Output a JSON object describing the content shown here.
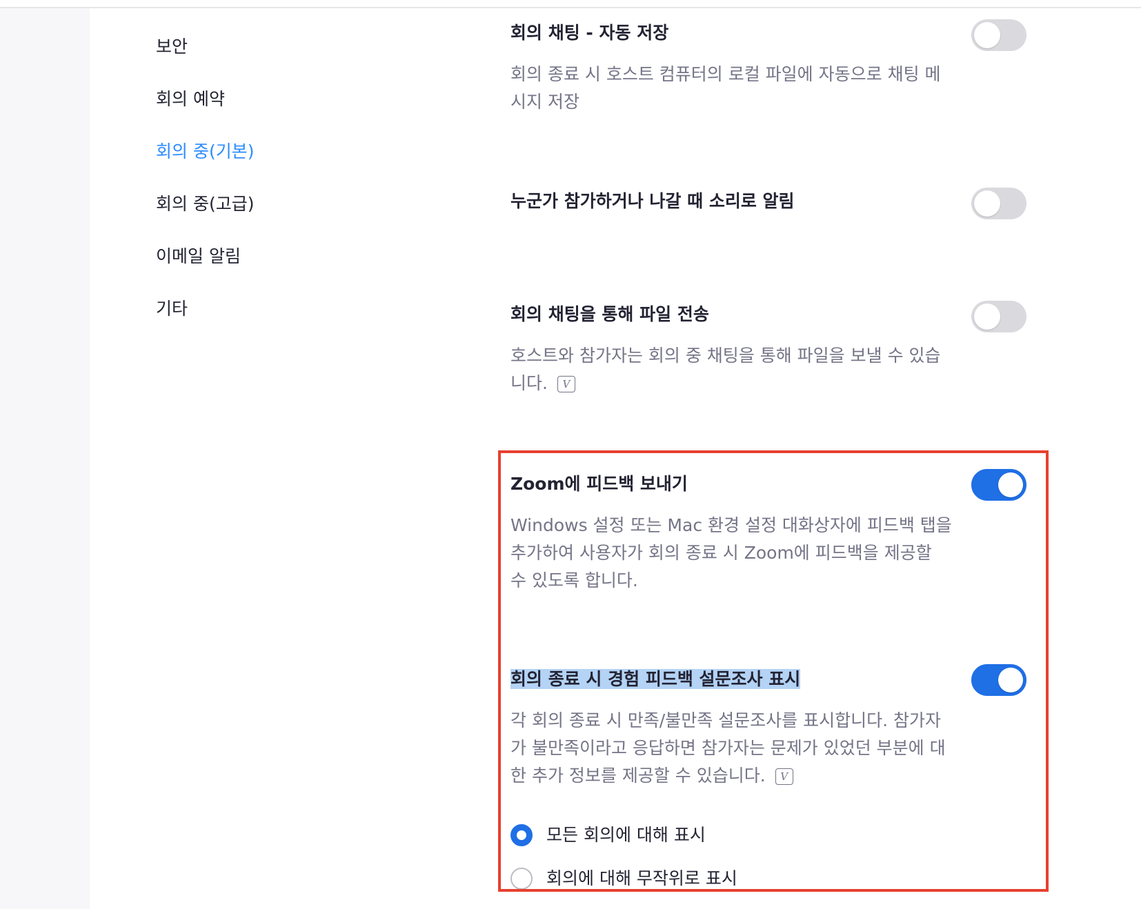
{
  "sidebar": {
    "items": [
      {
        "label": "보안",
        "active": false
      },
      {
        "label": "회의 예약",
        "active": false
      },
      {
        "label": "회의 중(기본)",
        "active": true
      },
      {
        "label": "회의 중(고급)",
        "active": false
      },
      {
        "label": "이메일 알림",
        "active": false
      },
      {
        "label": "기타",
        "active": false
      }
    ]
  },
  "settings": {
    "auto_save_chat": {
      "title": "회의 채팅 - 자동 저장",
      "description": "회의 종료 시 호스트 컴퓨터의 로컬 파일에 자동으로 채팅 메시지 저장",
      "enabled": false
    },
    "join_leave_sound": {
      "title": "누군가 참가하거나 나갈 때 소리로 알림",
      "enabled": false
    },
    "file_transfer": {
      "title": "회의 채팅을 통해 파일 전송",
      "description": "호스트와 참가자는 회의 중 채팅을 통해 파일을 보낼 수 있습니다.",
      "enabled": false
    },
    "zoom_feedback": {
      "title": "Zoom에 피드백 보내기",
      "description": "Windows 설정 또는 Mac 환경 설정 대화상자에 피드백 탭을 추가하여 사용자가 회의 종료 시 Zoom에 피드백을 제공할 수 있도록 합니다.",
      "enabled": true
    },
    "end_of_meeting_survey": {
      "title": "회의 종료 시 경험 피드백 설문조사 표시",
      "description": "각 회의 종료 시 만족/불만족 설문조사를 표시합니다. 참가자가 불만족이라고 응답하면 참가자는 문제가 있었던 부분에 대한 추가 정보를 제공할 수 있습니다.",
      "enabled": true,
      "options": [
        {
          "label": "모든 회의에 대해 표시",
          "selected": true
        },
        {
          "label": "회의에 대해 무작위로 표시",
          "selected": false
        }
      ]
    }
  },
  "icons": {
    "info": "V"
  },
  "colors": {
    "accent": "#1f6fe5",
    "active_nav": "#2D8CFF",
    "highlight_border": "#e8402f",
    "toggle_off": "#d9d9de",
    "text_primary": "#232333",
    "text_secondary": "#747487"
  }
}
